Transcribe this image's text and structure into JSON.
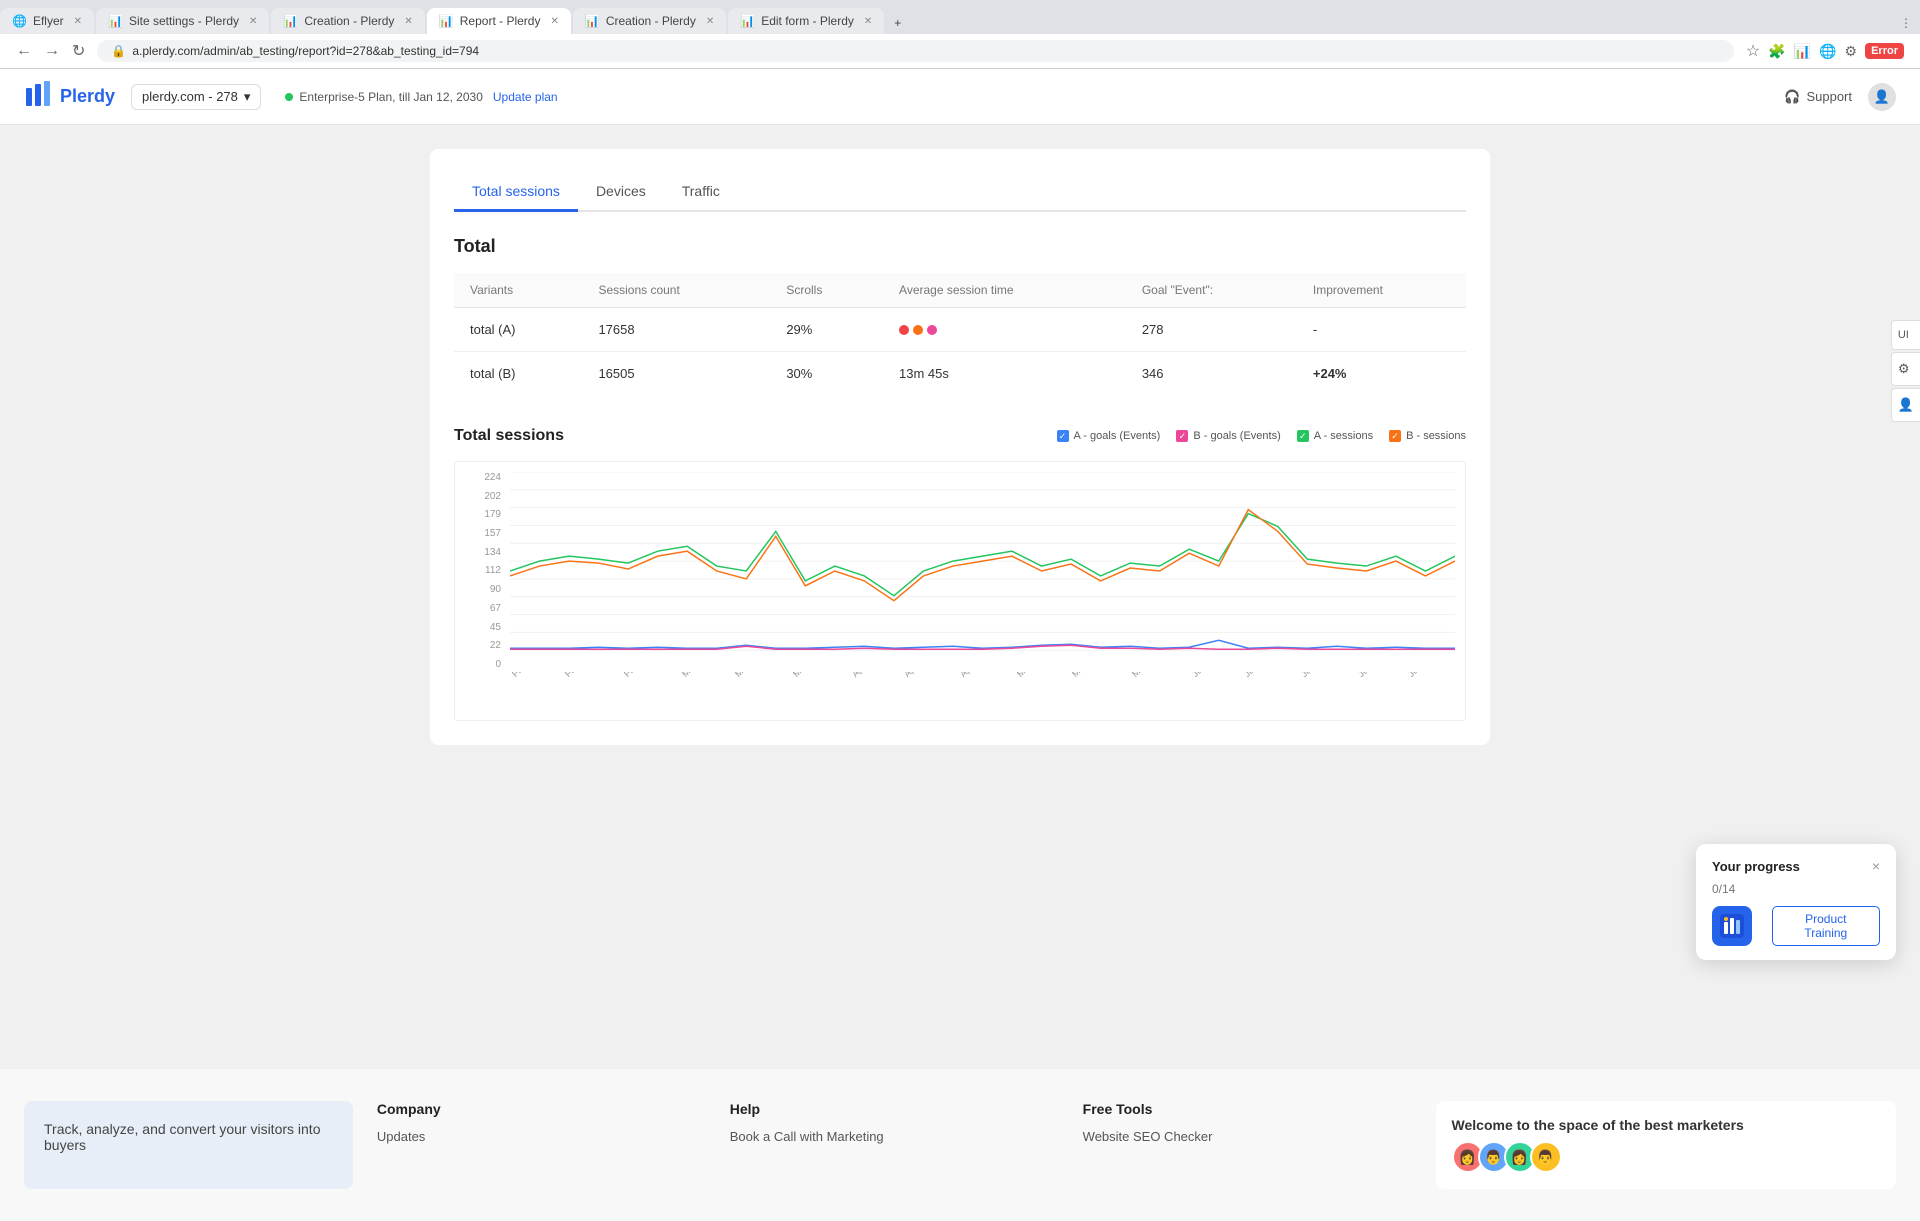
{
  "browser": {
    "tabs": [
      {
        "label": "Eflyer",
        "active": false,
        "icon": "🌐",
        "closable": true
      },
      {
        "label": "Site settings - Plerdy",
        "active": false,
        "icon": "📊",
        "closable": true
      },
      {
        "label": "Creation - Plerdy",
        "active": false,
        "icon": "📊",
        "closable": true
      },
      {
        "label": "Report - Plerdy",
        "active": true,
        "icon": "📊",
        "closable": true
      },
      {
        "label": "Creation - Plerdy",
        "active": false,
        "icon": "📊",
        "closable": true
      },
      {
        "label": "Edit form - Plerdy",
        "active": false,
        "icon": "📊",
        "closable": true
      }
    ],
    "url": "a.plerdy.com/admin/ab_testing/report?id=278&ab_testing_id=794",
    "error_badge": "Error"
  },
  "header": {
    "logo_text": "Plerdy",
    "site_selector": "plerdy.com - 278",
    "plan_text": "Enterprise-5 Plan, till Jan 12, 2030",
    "update_link": "Update plan",
    "support_label": "Support"
  },
  "page": {
    "tabs": [
      {
        "label": "Total sessions",
        "active": true
      },
      {
        "label": "Devices",
        "active": false
      },
      {
        "label": "Traffic",
        "active": false
      }
    ],
    "section_title": "Total",
    "table": {
      "headers": [
        "Variants",
        "Sessions count",
        "Scrolls",
        "Average session time",
        "Goal \"Event\":",
        "Improvement"
      ],
      "rows": [
        {
          "variant": "total (A)",
          "sessions": "17658",
          "scrolls": "29%",
          "avg_time": "···",
          "goal": "278",
          "improvement": "-",
          "improvement_type": "neutral"
        },
        {
          "variant": "total (B)",
          "sessions": "16505",
          "scrolls": "30%",
          "avg_time": "13m 45s",
          "goal": "346",
          "improvement": "+24%",
          "improvement_type": "positive"
        }
      ]
    },
    "chart": {
      "title": "Total sessions",
      "legend": [
        {
          "label": "A - goals (Events)",
          "color": "#3b82f6",
          "type": "check"
        },
        {
          "label": "B - goals (Events)",
          "color": "#ec4899",
          "type": "check"
        },
        {
          "label": "A - sessions",
          "color": "#22c55e",
          "type": "check"
        },
        {
          "label": "B - sessions",
          "color": "#f97316",
          "type": "check"
        }
      ],
      "y_labels": [
        "224",
        "202",
        "179",
        "157",
        "134",
        "112",
        "90",
        "67",
        "45",
        "22",
        "0"
      ],
      "x_labels": [
        "Feb 8, 2024",
        "Feb 18, 2024",
        "Feb 28, 2024",
        "Mar 9, 2024",
        "Mar 19, 2024",
        "Mar 29, 2024",
        "Apr 8, 2024",
        "Apr 19, 2024",
        "Apr 28, 2024",
        "May 8, 2024",
        "May 18, 2024",
        "May 28, 2024",
        "Jun 7, 2024",
        "Jun 17, 2024",
        "Jun 27, 2024",
        "Jul 7, 2024",
        "Jul 17, 2024"
      ]
    }
  },
  "side_panel": {
    "buttons": [
      "UI",
      "⚙",
      "👤"
    ]
  },
  "progress_widget": {
    "title": "Your progress",
    "count": "0/14",
    "close_label": "×",
    "cta_label": "Product Training"
  },
  "footer": {
    "description": "Track, analyze, and convert your visitors into buyers",
    "company": {
      "title": "Company",
      "links": [
        "Updates"
      ]
    },
    "help": {
      "title": "Help",
      "links": [
        "Book a Call with Marketing"
      ]
    },
    "free_tools": {
      "title": "Free Tools",
      "links": [
        "Website SEO Checker"
      ]
    },
    "community": {
      "title": "Welcome to the space of the best marketers"
    }
  }
}
